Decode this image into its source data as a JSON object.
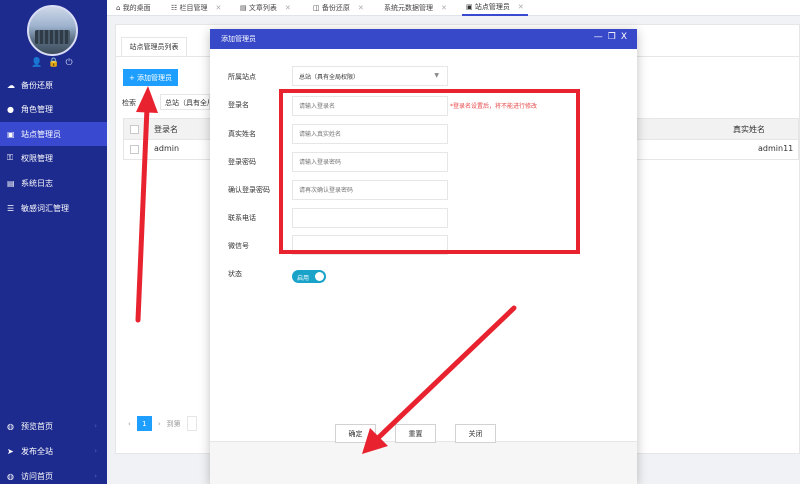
{
  "sidebar": {
    "user_icons": [
      "👤",
      "🔒",
      "⏻"
    ],
    "items": [
      {
        "label": "备份还原",
        "icon": "cloud-icon"
      },
      {
        "label": "角色管理",
        "icon": "person-icon"
      },
      {
        "label": "站点管理员",
        "icon": "id-card-icon"
      },
      {
        "label": "权限管理",
        "icon": "key-icon"
      },
      {
        "label": "系统日志",
        "icon": "log-icon"
      },
      {
        "label": "敏感词汇管理",
        "icon": "list-icon"
      }
    ],
    "bottom_items": [
      {
        "label": "预览首页",
        "icon": "globe-icon"
      },
      {
        "label": "发布全站",
        "icon": "send-icon"
      },
      {
        "label": "访问首页",
        "icon": "globe-icon"
      }
    ]
  },
  "tabs": [
    {
      "label": "我的桌面",
      "icon": "⌂"
    },
    {
      "label": "栏目管理",
      "icon": "☷"
    },
    {
      "label": "文章列表",
      "icon": "▤"
    },
    {
      "label": "备份还原",
      "icon": "◫"
    },
    {
      "label": "系统元数据管理",
      "icon": ""
    },
    {
      "label": "站点管理员",
      "icon": "▣"
    }
  ],
  "page": {
    "panel_tab": "站点管理员列表",
    "add_button": "+ 添加管理员",
    "filter_label": "检索",
    "filter_value": "总站（具有全局权",
    "table_headers": [
      "登录名",
      "真实姓名"
    ],
    "rows": [
      {
        "login": "admin",
        "real_name": "admin11"
      }
    ],
    "pager": {
      "current": "1",
      "goto": "到第"
    }
  },
  "modal": {
    "title": "添加管理员",
    "controls": [
      "—",
      "❐",
      "X"
    ],
    "fields": {
      "site": {
        "label": "所属站点",
        "value": "总站（具有全局权限）"
      },
      "login": {
        "label": "登录名",
        "placeholder": "请输入登录名"
      },
      "real_name": {
        "label": "真实姓名",
        "placeholder": "请输入真实姓名"
      },
      "password": {
        "label": "登录密码",
        "placeholder": "请输入登录密码"
      },
      "confirm_password": {
        "label": "确认登录密码",
        "placeholder": "请再次确认登录密码"
      },
      "phone": {
        "label": "联系电话",
        "placeholder": ""
      },
      "wechat": {
        "label": "微信号",
        "placeholder": ""
      },
      "status": {
        "label": "状态",
        "value": "启用"
      }
    },
    "hint": "*登录名设置后，将不能进行修改",
    "buttons": {
      "ok": "确定",
      "reset": "重置",
      "close": "关闭"
    }
  },
  "colors": {
    "sidebar": "#1d2a8e",
    "sidebar_active": "#3a4ad0",
    "modal_header": "#3749c8",
    "primary_button": "#1e9fff",
    "annotation_red": "#e8232f",
    "toggle_on": "#1aa3c9"
  }
}
